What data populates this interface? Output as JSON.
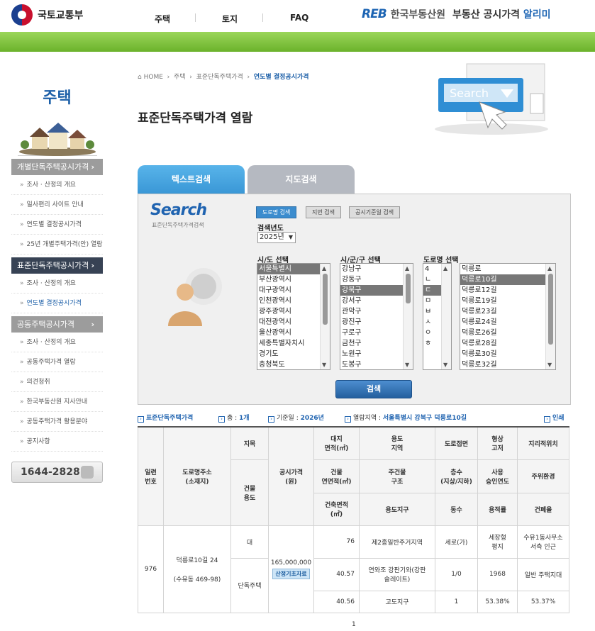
{
  "header": {
    "ministry": "국토교통부",
    "nav": [
      "주택",
      "토지",
      "FAQ"
    ],
    "reb_mark": "REB",
    "reb_name": "한국부동산원",
    "service_title_prefix": "부동산 공시가격",
    "service_title_highlight": "알리미"
  },
  "sidebar": {
    "title": "주택",
    "sections": [
      {
        "label": "개별단독주택공시가격",
        "style": "gray",
        "items": [
          "조사 · 산정의 개요",
          "일사편리 사이트 안내",
          "연도별 결정공시가격",
          "25년 개별주택가격(안) 열람"
        ]
      },
      {
        "label": "표준단독주택공시가격",
        "style": "dark",
        "items": [
          "조사 · 산정의 개요",
          "연도별 결정공시가격"
        ]
      },
      {
        "label": "공동주택공시가격",
        "style": "gray",
        "items": [
          "조사 · 산정의 개요",
          "공동주택가격 열람",
          "의견청취",
          "한국부동산원 지사안내",
          "공동주택가격 활용분야",
          "공지사항"
        ]
      }
    ],
    "phone": "1644-2828"
  },
  "breadcrumb": [
    "HOME",
    "주택",
    "표준단독주택가격",
    "연도별 결정공시가격"
  ],
  "page_title": "표준단독주택가격 열람",
  "illustration_text": "Search",
  "tabs": {
    "text_search": "텍스트검색",
    "map_search": "지도검색"
  },
  "search": {
    "logo": "Search",
    "logo_sub": "표준단독주택가격검색",
    "buttons": [
      "도로명 검색",
      "지번 검색",
      "공시기준일 검색"
    ],
    "year_label": "검색년도",
    "year_value": "2025년",
    "sido_label": "시/도 선택",
    "sido_options": [
      "서울특별시",
      "부산광역시",
      "대구광역시",
      "인천광역시",
      "광주광역시",
      "대전광역시",
      "울산광역시",
      "세종특별자치시",
      "경기도",
      "충청북도"
    ],
    "sido_selected": 0,
    "sgg_label": "시/군/구 선택",
    "sgg_options": [
      "강남구",
      "강동구",
      "강북구",
      "강서구",
      "관악구",
      "광진구",
      "구로구",
      "금천구",
      "노원구",
      "도봉구"
    ],
    "sgg_selected": 2,
    "road_label": "도로명 선택",
    "initials": [
      "4",
      "ㄴ",
      "ㄷ",
      "ㅁ",
      "ㅂ",
      "ㅅ",
      "ㅇ",
      "ㅎ"
    ],
    "initial_selected": 2,
    "road_options": [
      "덕릉로",
      "덕릉로10길",
      "덕릉로12길",
      "덕릉로19길",
      "덕릉로23길",
      "덕릉로24길",
      "덕릉로26길",
      "덕릉로28길",
      "덕릉로30길",
      "덕릉로32길"
    ],
    "road_selected": 1,
    "submit": "검색"
  },
  "result_info": {
    "category": "표준단독주택가격",
    "count_label": "총 : ",
    "count": "1개",
    "base_date_label": "기준일 : ",
    "base_date": "2026년",
    "area_label": "열람지역 : ",
    "area": "서울특별시 강북구 덕릉로10길",
    "print": "인쇄"
  },
  "table": {
    "headers": {
      "serial": "일련\n번호",
      "address": "도로명주소\n(소재지)",
      "jimok": "지목",
      "bldg_use": "건물\n용도",
      "price": "공시가격\n(원)",
      "land_area": "대지\n면적(㎡)",
      "use_zone": "용도\n지역",
      "road": "도로접면",
      "shape": "형상\n고저",
      "location": "지리적위치",
      "floor_area": "건물\n연면적(㎡)",
      "structure": "주건물\n구조",
      "floors": "층수\n(지상/지하)",
      "approval": "사용\n승인연도",
      "env": "주위환경",
      "building_area": "건축면적\n(㎡)",
      "use_district": "용도지구",
      "dong_count": "동수",
      "far": "용적률",
      "bcr": "건폐율"
    },
    "row": {
      "serial": "976",
      "address": "덕릉로10길 24",
      "address_lot": "(수유동 469-98)",
      "jimok": "대",
      "bldg_use": "단독주택",
      "price": "165,000,000",
      "calc_button": "산정기초자료",
      "land_area": "76",
      "use_zone": "제2종일반주거지역",
      "road": "세로(가)",
      "shape": "세장형\n평지",
      "location": "수유1동사무소\n서측 인근",
      "floor_area": "40.57",
      "structure": "연와조 강판기와(강판\n슬레이트)",
      "floors": "1/0",
      "approval": "1968",
      "env": "일반 주택지대",
      "building_area": "40.56",
      "use_district": "고도지구",
      "dong_count": "1",
      "far": "53.38%",
      "bcr": "53.37%"
    }
  },
  "pagination": {
    "current": "1"
  }
}
